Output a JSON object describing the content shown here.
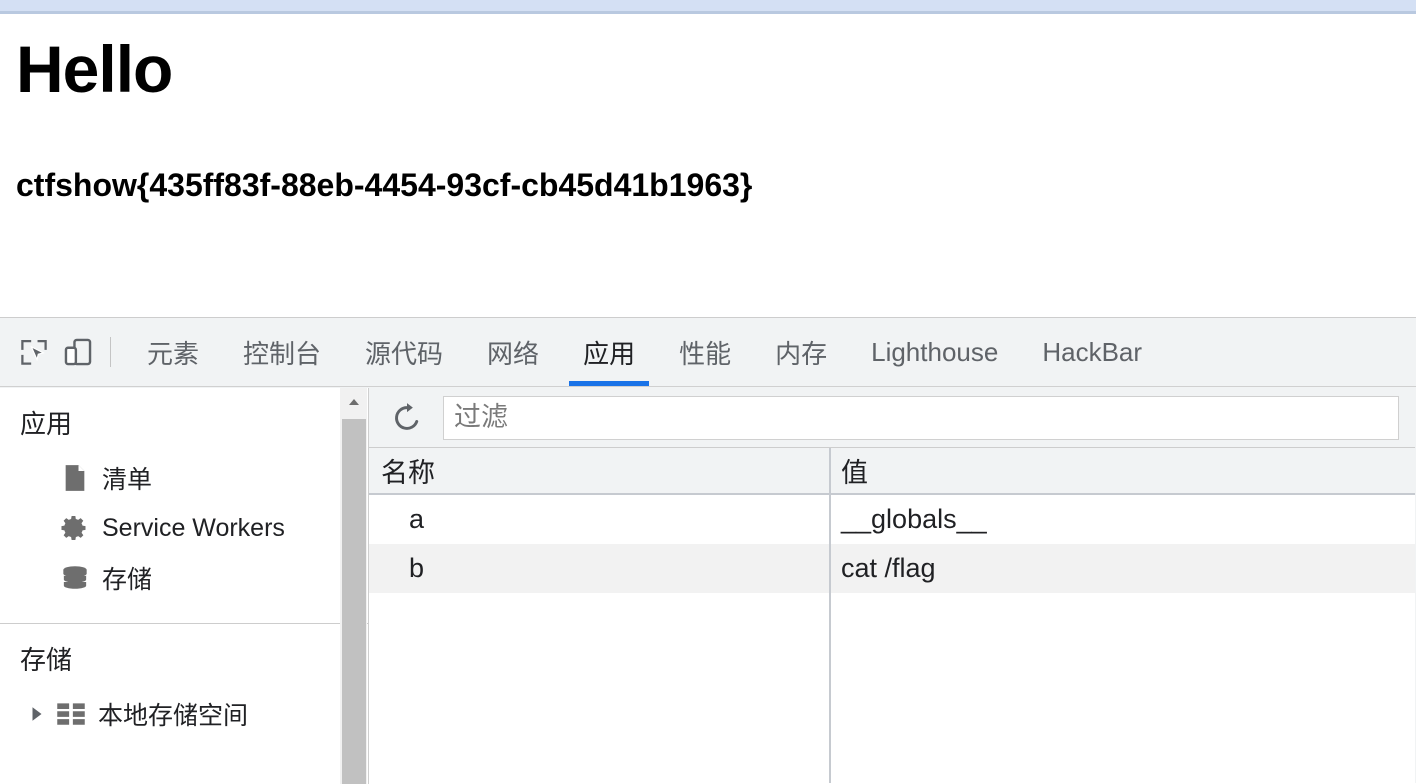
{
  "browser": {
    "strip_color": "#d4e0f4"
  },
  "page": {
    "heading": "Hello",
    "flag": "ctfshow{435ff83f-88eb-4454-93cf-cb45d41b1963}"
  },
  "devtools": {
    "toolbar_icons": [
      {
        "name": "inspect-element-icon"
      },
      {
        "name": "device-toolbar-icon"
      }
    ],
    "tabs": [
      {
        "label": "元素",
        "active": false
      },
      {
        "label": "控制台",
        "active": false
      },
      {
        "label": "源代码",
        "active": false
      },
      {
        "label": "网络",
        "active": false
      },
      {
        "label": "应用",
        "active": true
      },
      {
        "label": "性能",
        "active": false
      },
      {
        "label": "内存",
        "active": false
      },
      {
        "label": "Lighthouse",
        "active": false
      },
      {
        "label": "HackBar",
        "active": false
      }
    ],
    "active_tab_color": "#1a73e8",
    "sidebar": {
      "sections": [
        {
          "title": "应用",
          "items": [
            {
              "label": "清单",
              "icon": "manifest-document-icon"
            },
            {
              "label": "Service Workers",
              "icon": "gear-icon"
            },
            {
              "label": "存储",
              "icon": "database-icon"
            }
          ]
        },
        {
          "title": "存储",
          "items": [
            {
              "label": "本地存储空间",
              "icon": "table-grid-icon",
              "twisty": "chevron-right-icon"
            }
          ]
        }
      ],
      "scrollbar": {
        "up_arrow": "scroll-up-arrow-icon"
      }
    },
    "main": {
      "refresh_icon": "refresh-icon",
      "filter": {
        "placeholder": "过滤",
        "value": ""
      },
      "table": {
        "columns": [
          "名称",
          "值"
        ],
        "rows": [
          {
            "name": "a",
            "value": "__globals__"
          },
          {
            "name": "b",
            "value": "cat /flag"
          }
        ]
      }
    }
  }
}
